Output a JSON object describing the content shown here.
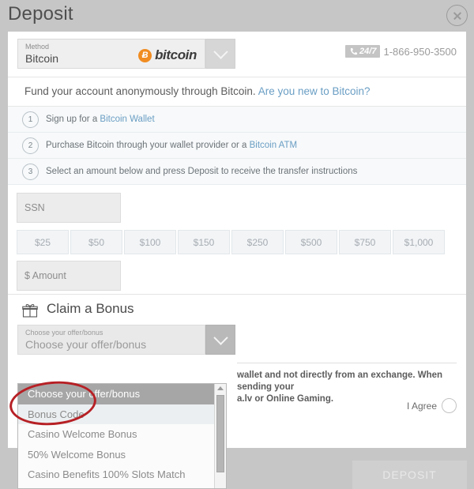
{
  "header": {
    "title": "Deposit",
    "close_label": "×"
  },
  "method": {
    "label": "Method",
    "value": "Bitcoin",
    "logo_text": "bitcoin",
    "logo_symbol": "Ƀ",
    "caret_icon": "chevron-down-icon"
  },
  "support": {
    "badge": "24/7",
    "phone": "1-866-950-3500"
  },
  "intro": {
    "text": "Fund your account anonymously through Bitcoin. ",
    "link": "Are you new to Bitcoin?"
  },
  "steps": [
    {
      "num": "1",
      "pre": "Sign up for a ",
      "link": "Bitcoin Wallet",
      "post": ""
    },
    {
      "num": "2",
      "pre": "Purchase Bitcoin through your wallet provider or a ",
      "link": "Bitcoin ATM",
      "post": ""
    },
    {
      "num": "3",
      "pre": "Select an amount below and press Deposit to receive the transfer instructions",
      "link": "",
      "post": ""
    }
  ],
  "amount": {
    "ssn_placeholder": "SSN",
    "amount_placeholder": "$ Amount",
    "chips": [
      "$25",
      "$50",
      "$100",
      "$150",
      "$250",
      "$500",
      "$750",
      "$1,000"
    ]
  },
  "bonus": {
    "icon": "gift-icon",
    "title": "Claim a Bonus",
    "select_label": "Choose your offer/bonus",
    "select_value": "Choose your offer/bonus",
    "options": [
      "Choose your offer/bonus",
      "Bonus Code",
      "Casino Welcome Bonus",
      "50% Welcome Bonus",
      "Casino Benefits 100% Slots Match"
    ],
    "selected_index": 0
  },
  "disclaimer": {
    "line1": "wallet and not directly from an exchange. When sending your",
    "line2": "a.lv or Online Gaming.",
    "agree_label": "I Agree"
  },
  "footer": {
    "deposit_label": "DEPOSIT"
  },
  "colors": {
    "accent_link": "#6a9ec4",
    "bitcoin_orange": "#f08c21",
    "annotation_red": "#b62025",
    "modal_backdrop": "#c6c6c6"
  }
}
